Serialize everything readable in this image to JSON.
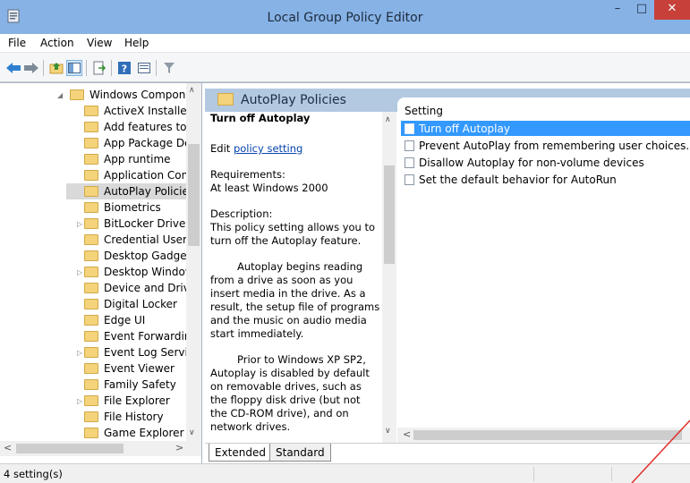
{
  "window": {
    "title": "Local Group Policy Editor",
    "controls": {
      "minimize": "–",
      "maximize": "□",
      "close": "✕"
    }
  },
  "menu": [
    "File",
    "Action",
    "View",
    "Help"
  ],
  "toolbar": {
    "icons": [
      "back-arrow-icon",
      "forward-arrow-icon",
      "up-folder-icon",
      "show-hide-tree-icon",
      "export-list-icon",
      "help-icon",
      "properties-icon",
      "filter-icon"
    ]
  },
  "tree": {
    "items": [
      {
        "label": "Windows Compone",
        "expander": "◢",
        "indent": 0
      },
      {
        "label": "ActiveX Installer",
        "expander": "",
        "indent": 1
      },
      {
        "label": "Add features to \\",
        "expander": "",
        "indent": 1
      },
      {
        "label": "App Package De",
        "expander": "",
        "indent": 1
      },
      {
        "label": "App runtime",
        "expander": "",
        "indent": 1
      },
      {
        "label": "Application Con",
        "expander": "",
        "indent": 1
      },
      {
        "label": "AutoPlay Policie",
        "expander": "",
        "indent": 1,
        "selected": true
      },
      {
        "label": "Biometrics",
        "expander": "",
        "indent": 1
      },
      {
        "label": "BitLocker Drive E",
        "expander": "▷",
        "indent": 1
      },
      {
        "label": "Credential User I",
        "expander": "",
        "indent": 1
      },
      {
        "label": "Desktop Gadget",
        "expander": "",
        "indent": 1
      },
      {
        "label": "Desktop Window",
        "expander": "▷",
        "indent": 1
      },
      {
        "label": "Device and Drive",
        "expander": "",
        "indent": 1
      },
      {
        "label": "Digital Locker",
        "expander": "",
        "indent": 1
      },
      {
        "label": "Edge UI",
        "expander": "",
        "indent": 1
      },
      {
        "label": "Event Forwardin",
        "expander": "",
        "indent": 1
      },
      {
        "label": "Event Log Servic",
        "expander": "▷",
        "indent": 1
      },
      {
        "label": "Event Viewer",
        "expander": "",
        "indent": 1
      },
      {
        "label": "Family Safety",
        "expander": "",
        "indent": 1
      },
      {
        "label": "File Explorer",
        "expander": "▷",
        "indent": 1
      },
      {
        "label": "File History",
        "expander": "",
        "indent": 1
      },
      {
        "label": "Game Explorer",
        "expander": "",
        "indent": 1
      }
    ],
    "scroll_up": "∧",
    "scroll_down": "∨",
    "scroll_left": "<",
    "scroll_right": ">"
  },
  "panel": {
    "header": "AutoPlay Policies",
    "desc_title": "Turn off Autoplay",
    "edit_prefix": "Edit ",
    "edit_link": "policy setting",
    "requirements_label": "Requirements:",
    "requirements_value": "At least Windows 2000",
    "description_label": "Description:",
    "description_p1": "This policy setting allows you to turn off the Autoplay feature.",
    "description_p2": "Autoplay begins reading from a drive as soon as you insert media in the drive. As a result, the setup file of programs and the music on audio media start immediately.",
    "description_p3": "Prior to Windows XP SP2, Autoplay is disabled by default on removable drives, such as the floppy disk drive (but not the CD-ROM drive), and on network drives.",
    "scroll_up": "∧",
    "scroll_down": "∨"
  },
  "list": {
    "column": "Setting",
    "rows": [
      {
        "label": "Turn off Autoplay",
        "selected": true
      },
      {
        "label": "Prevent AutoPlay from remembering user choices.",
        "selected": false
      },
      {
        "label": "Disallow Autoplay for non-volume devices",
        "selected": false
      },
      {
        "label": "Set the default behavior for AutoRun",
        "selected": false
      }
    ],
    "scroll_left": "<",
    "scroll_right": ">"
  },
  "tabs": [
    "Extended",
    "Standard"
  ],
  "status": {
    "text": "4 setting(s)"
  },
  "colors": {
    "titlebar": "#87b2e6",
    "close": "#c7403a",
    "selection": "#3399ff",
    "header": "#b3c9e1",
    "annotation": "#e0302a"
  }
}
